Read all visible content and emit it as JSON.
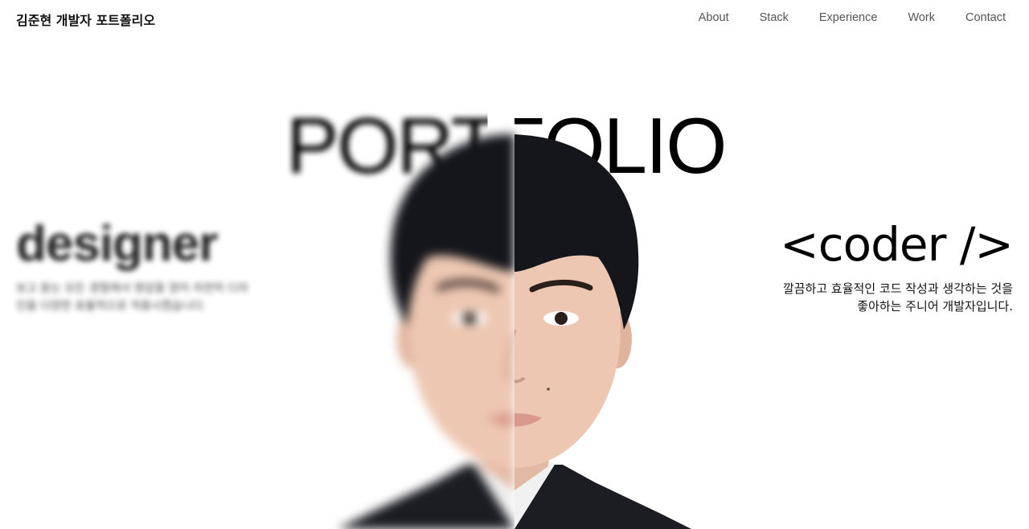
{
  "header": {
    "brand": "김준현 개발자 포트폴리오",
    "nav": [
      "About",
      "Stack",
      "Experience",
      "Work",
      "Contact"
    ]
  },
  "hero": {
    "title": "PORTFOLIO",
    "left": {
      "heading": "designer",
      "description": "보고 듣는 모든 경험에서 영감을 얻어 자연히 디자인을 다양한 효율적으로 적용시켰습니다."
    },
    "right": {
      "heading": "<coder />",
      "description_line1": "깔끔하고 효율적인 코드 작성과 생각하는 것을",
      "description_line2": "좋아하는 주니어 개발자입니다."
    }
  },
  "colors": {
    "text": "#111111",
    "nav": "#555555",
    "background": "#ffffff"
  }
}
